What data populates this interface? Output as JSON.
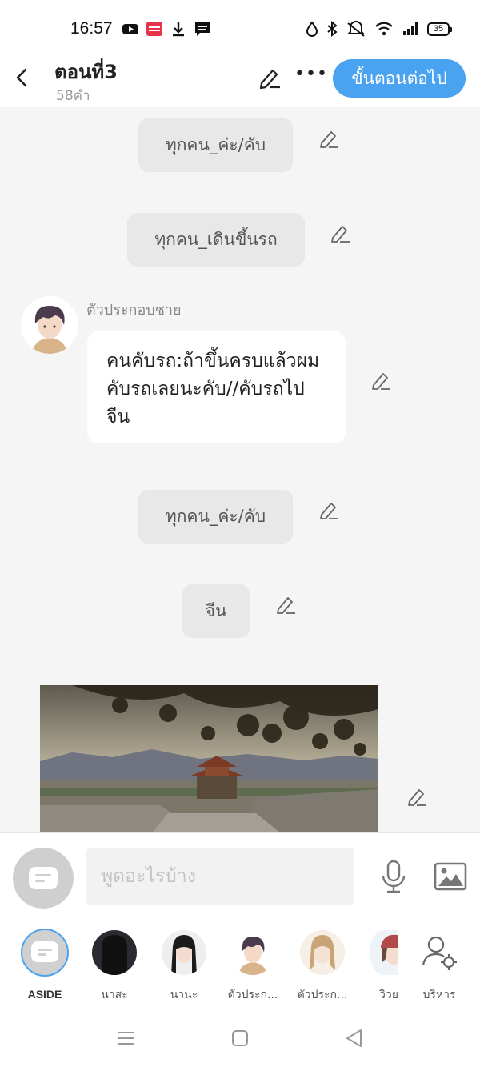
{
  "status_bar": {
    "time": "16:57",
    "battery": "35",
    "left_icons": [
      "youtube-icon",
      "mangatoon-icon",
      "download-icon",
      "webtoon-icon"
    ],
    "right_icons": [
      "drop-icon",
      "bluetooth-icon",
      "mute-icon",
      "wifi-icon",
      "signal-icon",
      "battery-icon"
    ]
  },
  "header": {
    "title": "ตอนที่3",
    "word_count": "58คำ",
    "next_button": "ขั้นตอนต่อไป",
    "more_label": "•••"
  },
  "messages": [
    {
      "type": "narration",
      "text": "ทุกคน_ค่ะ/คับ"
    },
    {
      "type": "narration",
      "text": "ทุกคน_เดินขึ้นรถ"
    },
    {
      "type": "dialogue",
      "speaker": "ตัวประกอบชาย",
      "text": "คนคับรถ:ถ้าขึ้นครบแล้วผมคับรถเลยนะคับ//คับรถไปจีน"
    },
    {
      "type": "narration",
      "text": "ทุกคน_ค่ะ/คับ"
    },
    {
      "type": "narration",
      "text": "จีน"
    },
    {
      "type": "image",
      "alt_icon": "scene-image"
    }
  ],
  "input": {
    "placeholder": "พูดอะไรบ้าง"
  },
  "characters": [
    {
      "label": "ASIDE",
      "active": true
    },
    {
      "label": "นาสะ",
      "active": false
    },
    {
      "label": "นานะ",
      "active": false
    },
    {
      "label": "ตัวประก...",
      "active": false
    },
    {
      "label": "ตัวประก...",
      "active": false
    },
    {
      "label": "วิวย",
      "active": false
    },
    {
      "label": "บริหาร",
      "active": false
    }
  ],
  "colors": {
    "accent": "#4aa3f0",
    "chat_background": "#f5f5f5",
    "narration_bubble": "#e8e8e8"
  }
}
